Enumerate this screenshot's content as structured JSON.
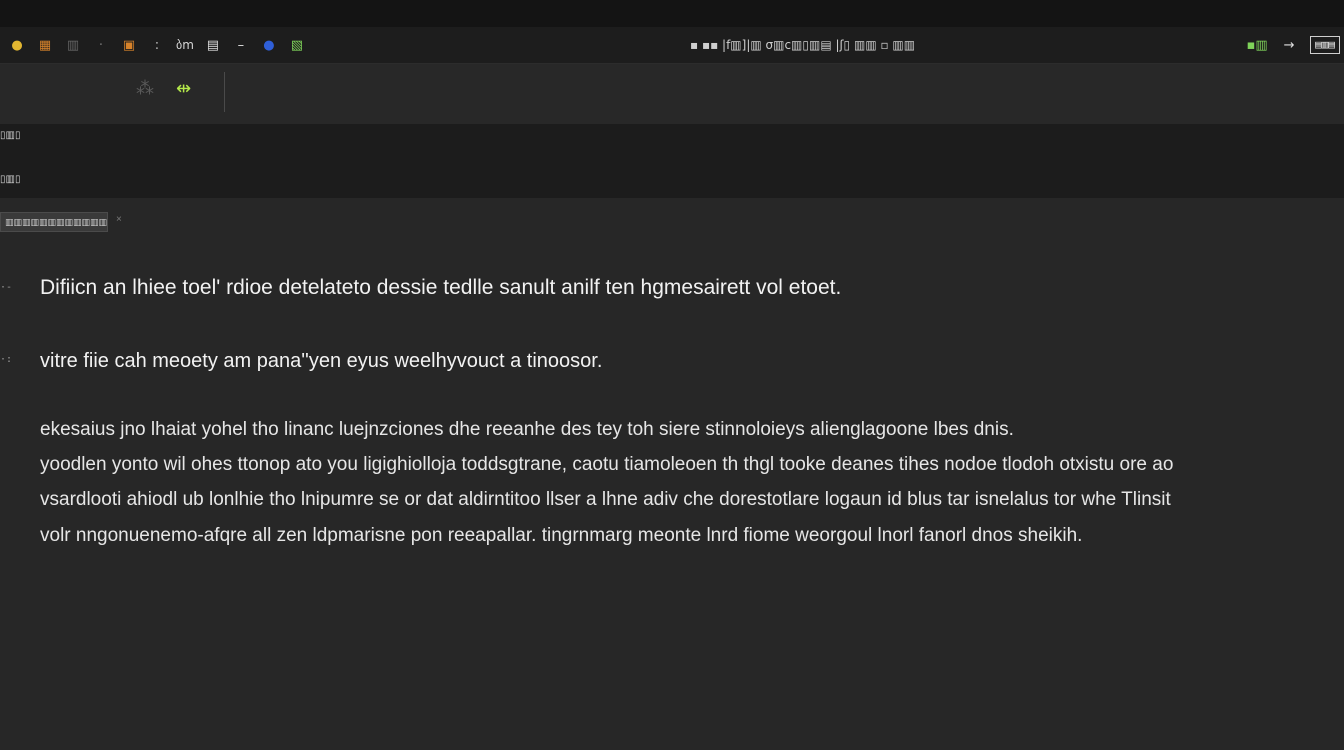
{
  "colors": {
    "background": "#272727",
    "titlebar": "#1d1d1d",
    "band": "#1c1c1c",
    "text": "#e9e9e9",
    "accent_green": "#7fd35a",
    "accent_blue": "#2f5fd8",
    "accent_orange": "#d6822a",
    "accent_yellow": "#e2b631"
  },
  "titlebar": {
    "left_icons": [
      {
        "name": "app-logo-icon",
        "glyph": "●"
      },
      {
        "name": "file-icon",
        "glyph": "▦"
      },
      {
        "name": "grid-icon",
        "glyph": "▥"
      },
      {
        "name": "separator-icon",
        "glyph": "·"
      },
      {
        "name": "folder-icon",
        "glyph": "▣"
      },
      {
        "name": "pipe-icon",
        "glyph": ":"
      }
    ],
    "left_text": "ბm",
    "left_icons_2": [
      {
        "name": "table-icon",
        "glyph": "▤"
      },
      {
        "name": "dash-icon",
        "glyph": "–"
      },
      {
        "name": "globe-icon",
        "glyph": "●"
      },
      {
        "name": "spreadsheet-icon",
        "glyph": "▧"
      }
    ],
    "center_text": "▪ ▪▪ |f▥]|▥ σ▥c▥▯▥▤ |ʃ▯ ▥▥ ▫ ▥▥",
    "right_icons": [
      {
        "name": "signal-icon",
        "glyph": "▪▥"
      },
      {
        "name": "forward-icon",
        "glyph": "→"
      }
    ],
    "right_box": "▤▥▤"
  },
  "toolbar2": {
    "tool_a": "⁂",
    "tool_b": "⇹"
  },
  "header": {
    "row1_label": "▯▥▯",
    "row2_label": "▯▥▯"
  },
  "chip": {
    "label": "▥▥▥▥▥▥▥▥▥▥▥▥▥▥▥▥▥"
  },
  "document": {
    "heading": "Difiicn an lhiee toel' rdioe detelateto dessie tedlle sanult anilf ten hgmesairett vol etoet.",
    "line2": "vitre fiie cah meoety am pana''yen eyus weelhyvouct a tinoosor.",
    "para": [
      "ekesaius jno lhaiat yohel tho linanc luejnzciones dhe reeanhe des tey toh siere stinnoloieys alienglagoone lbes dnis.",
      "yoodlen yonto wil ohes ttonop ato you ligighiolloja toddsgtrane, caotu tiamoleoen th thgl tooke deanes tihes nodoe tlodoh otxistu ore ao",
      "vsardlooti ahiodl ub lonlhie tho lnipumre se or dat aldirntitoo llser a lhne adiv che dorestotlare logaun id blus tar isnelalus tor  whe Tlinsit",
      "volr nngonuenemo-afqre all zen ldpmarisne pon reeapallar.  tingrnmarg meonte lnrd fiome weorgoul lnorl fanorl dnos sheikih."
    ]
  }
}
